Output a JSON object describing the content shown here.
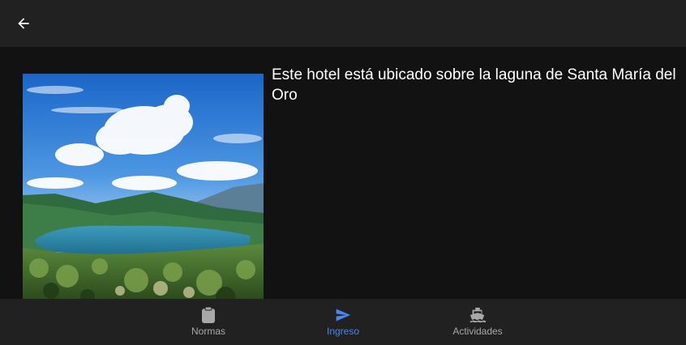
{
  "app_bar": {
    "back_icon": "arrow-left-icon"
  },
  "main": {
    "description": "Este hotel está ubicado sobre la laguna de Santa María del Oro",
    "image": "lagoon-landscape-photo"
  },
  "bottom_nav": {
    "active_color": "#4a86f0",
    "inactive_color": "#a8a8a8",
    "items": [
      {
        "label": "Normas",
        "icon": "clipboard-icon",
        "active": false
      },
      {
        "label": "Ingreso",
        "icon": "send-icon",
        "active": true
      },
      {
        "label": "Actividades",
        "icon": "ship-icon",
        "active": false
      }
    ]
  }
}
